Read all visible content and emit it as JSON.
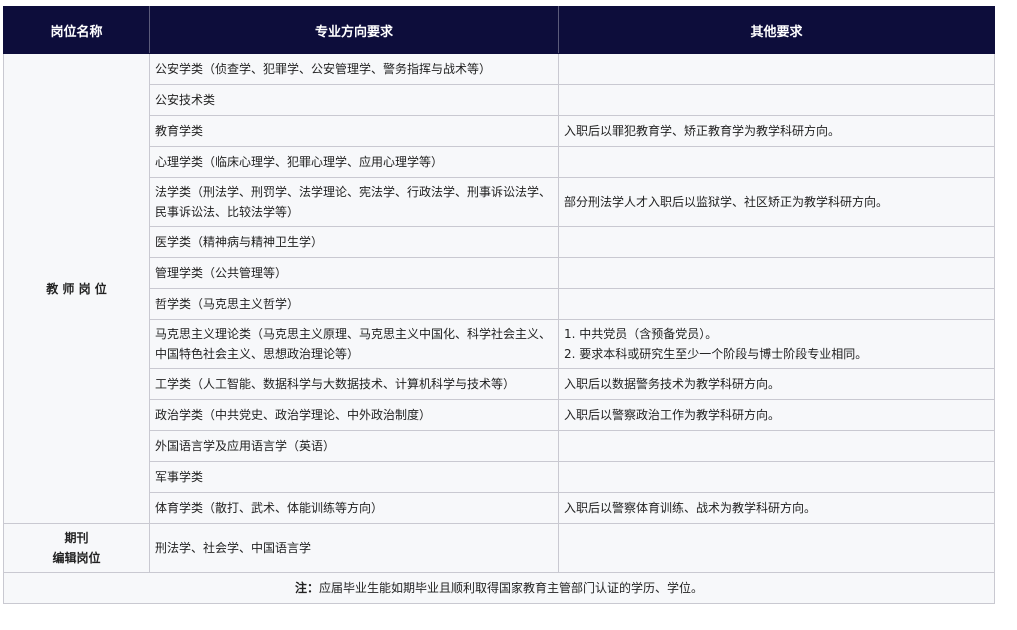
{
  "header": {
    "col1": "岗位名称",
    "col2": "专业方向要求",
    "col3": "其他要求"
  },
  "teacher": {
    "position": "教 师 岗 位",
    "rows": [
      {
        "major": [
          "公安学类（侦查学、犯罪学、公安管理学、警务指挥与战术等）"
        ],
        "other": []
      },
      {
        "major": [
          "公安技术类"
        ],
        "other": []
      },
      {
        "major": [
          "教育学类"
        ],
        "other": [
          "入职后以罪犯教育学、矫正教育学为教学科研方向。"
        ]
      },
      {
        "major": [
          "心理学类（临床心理学、犯罪心理学、应用心理学等）"
        ],
        "other": []
      },
      {
        "major": [
          "法学类（刑法学、刑罚学、法学理论、宪法学、行政法学、刑事诉讼法学、",
          "民事诉讼法、比较法学等）"
        ],
        "other": [
          "部分刑法学人才入职后以监狱学、社区矫正为教学科研方向。"
        ]
      },
      {
        "major": [
          "医学类（精神病与精神卫生学）"
        ],
        "other": []
      },
      {
        "major": [
          "管理学类（公共管理等）"
        ],
        "other": []
      },
      {
        "major": [
          "哲学类（马克思主义哲学）"
        ],
        "other": []
      },
      {
        "major": [
          "马克思主义理论类（马克思主义原理、马克思主义中国化、科学社会主义、",
          "中国特色社会主义、思想政治理论等）"
        ],
        "other": [
          "1. 中共党员（含预备党员）。",
          "2. 要求本科或研究生至少一个阶段与博士阶段专业相同。"
        ]
      },
      {
        "major": [
          "工学类（人工智能、数据科学与大数据技术、计算机科学与技术等）"
        ],
        "other": [
          "入职后以数据警务技术为教学科研方向。"
        ]
      },
      {
        "major": [
          "政治学类（中共党史、政治学理论、中外政治制度）"
        ],
        "other": [
          "入职后以警察政治工作为教学科研方向。"
        ]
      },
      {
        "major": [
          "外国语言学及应用语言学（英语）"
        ],
        "other": []
      },
      {
        "major": [
          "军事学类"
        ],
        "other": []
      },
      {
        "major": [
          "体育学类（散打、武术、体能训练等方向）"
        ],
        "other": [
          "入职后以警察体育训练、战术为教学科研方向。"
        ]
      }
    ]
  },
  "editor": {
    "position_line1": "期刊",
    "position_line2": "编辑岗位",
    "major": "刑法学、社会学、中国语言学",
    "other": ""
  },
  "note": {
    "label": "注：",
    "text": "应届毕业生能如期毕业且顺利取得国家教育主管部门认证的学历、学位。"
  }
}
